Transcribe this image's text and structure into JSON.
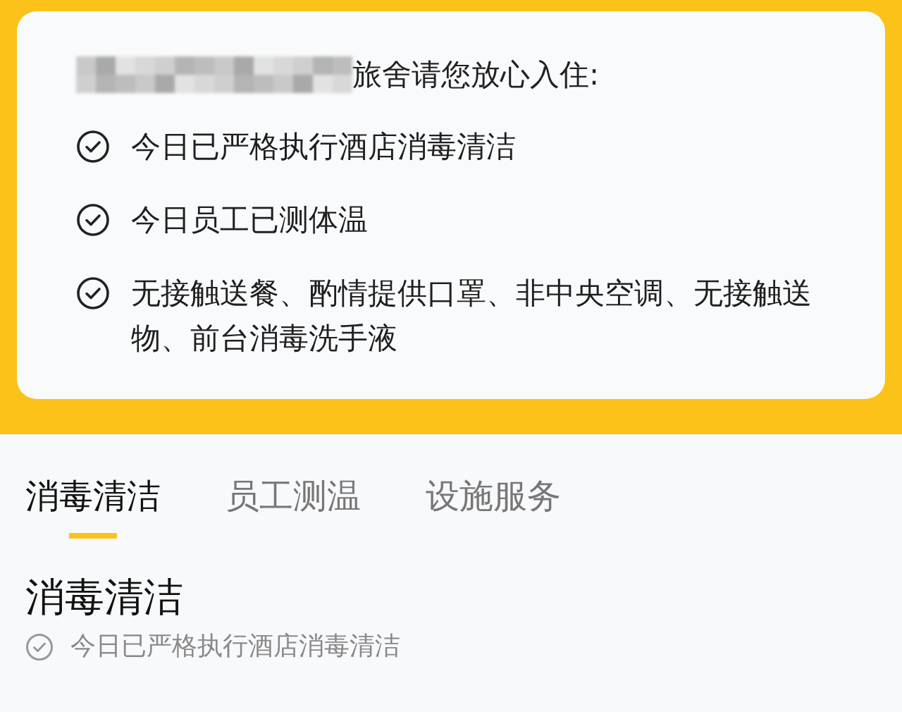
{
  "notice": {
    "heading": "旅舍请您放心入住:",
    "items": [
      {
        "text": "今日已严格执行酒店消毒清洁",
        "checked": true
      },
      {
        "text": "今日员工已测体温",
        "checked": true
      },
      {
        "text": "无接触送餐、酌情提供口罩、非中央空调、无接触送物、前台消毒洗手液",
        "checked": true
      }
    ]
  },
  "tabs": [
    {
      "label": "消毒清洁",
      "selected": true
    },
    {
      "label": "员工测温",
      "selected": false
    },
    {
      "label": "设施服务",
      "selected": false
    }
  ],
  "section": {
    "title": "消毒清洁",
    "items": [
      {
        "text": "今日已严格执行酒店消毒清洁",
        "checked": true
      }
    ]
  }
}
